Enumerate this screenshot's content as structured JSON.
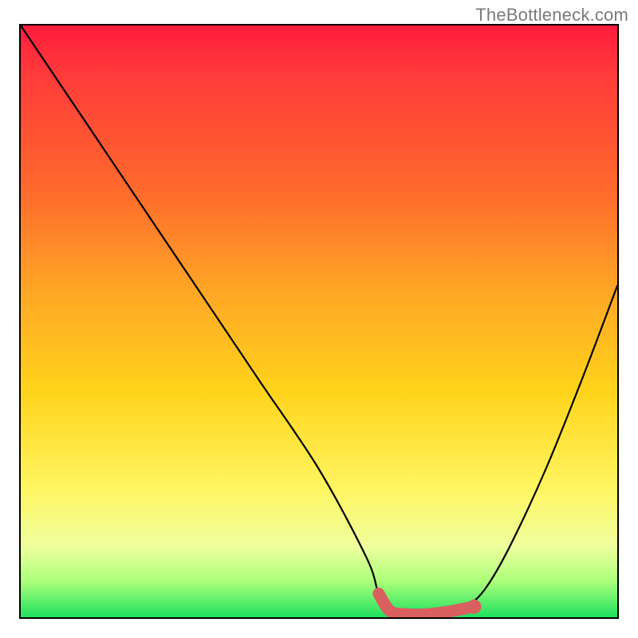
{
  "watermark": "TheBottleneck.com",
  "colors": {
    "frame": "#000000",
    "curve": "#000000",
    "marker": "#d9605f"
  },
  "chart_data": {
    "type": "line",
    "title": "",
    "xlabel": "",
    "ylabel": "",
    "xlim": [
      0,
      100
    ],
    "ylim": [
      0,
      100
    ],
    "grid": false,
    "legend": false,
    "series": [
      {
        "name": "bottleneck-curve",
        "x": [
          0,
          10,
          20,
          30,
          40,
          50,
          58,
          60,
          62,
          65,
          68,
          72,
          75,
          78,
          82,
          88,
          94,
          100
        ],
        "y": [
          100,
          85,
          70,
          55,
          40,
          25,
          10,
          4,
          1,
          0.5,
          0.5,
          1,
          2,
          5,
          12,
          25,
          40,
          56
        ]
      }
    ],
    "marker_region": {
      "name": "optimal-range",
      "x": [
        60,
        62,
        65,
        68,
        72,
        76
      ],
      "y": [
        4,
        1,
        0.5,
        0.5,
        1,
        1.8
      ]
    },
    "gradient_stops": [
      {
        "pct": 0,
        "color": "#ff1c3c"
      },
      {
        "pct": 28,
        "color": "#ff6a2c"
      },
      {
        "pct": 62,
        "color": "#ffd41b"
      },
      {
        "pct": 88,
        "color": "#efff9e"
      },
      {
        "pct": 100,
        "color": "#1ee05e"
      }
    ]
  }
}
